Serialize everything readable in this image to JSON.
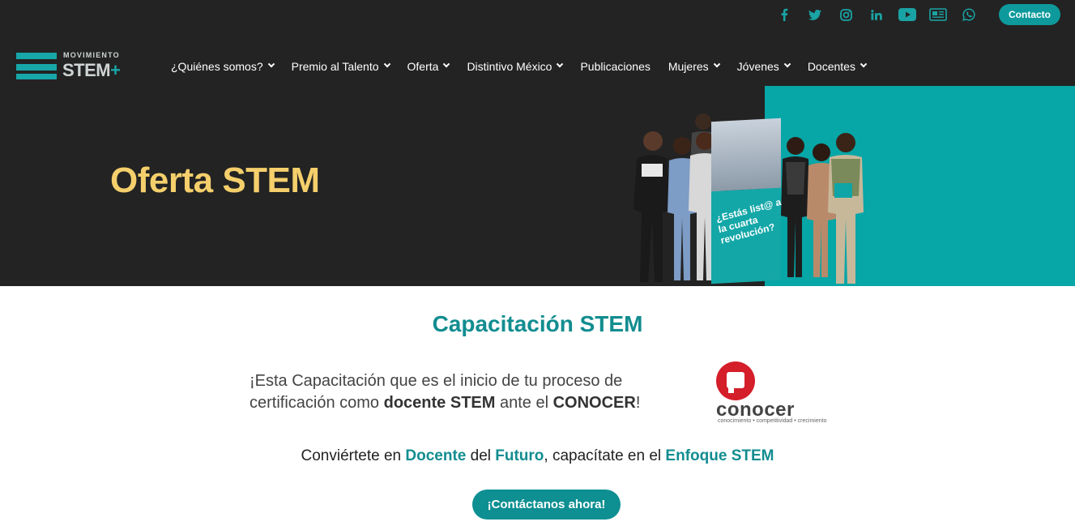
{
  "header": {
    "logo": {
      "small_text": "MOVIMIENTO",
      "big_text": "STEM",
      "plus": "+"
    },
    "social_icons": [
      "facebook-icon",
      "twitter-icon",
      "instagram-icon",
      "linkedin-icon",
      "youtube-icon",
      "newspaper-icon",
      "whatsapp-icon"
    ],
    "contact_label": "Contacto",
    "nav": [
      {
        "label": "¿Quiénes somos?",
        "dropdown": true
      },
      {
        "label": "Premio al Talento",
        "dropdown": true
      },
      {
        "label": "Oferta",
        "dropdown": true
      },
      {
        "label": "Distintivo México",
        "dropdown": true
      },
      {
        "label": "Publicaciones",
        "dropdown": false
      },
      {
        "label": "Mujeres",
        "dropdown": true
      },
      {
        "label": "Jóvenes",
        "dropdown": true
      },
      {
        "label": "Docentes",
        "dropdown": true
      }
    ]
  },
  "hero": {
    "title": "Oferta STEM",
    "banner_text": "¿Estás list@ a la cuarta revolución?"
  },
  "content": {
    "section_title": "Capacitación STEM",
    "cert_part1": "¡Esta Capacitación que es el inicio de tu proceso de certificación como ",
    "cert_bold1": "docente STEM",
    "cert_part2": " ante el ",
    "cert_bold2": "CONOCER",
    "cert_part3": "!",
    "conocer_name": "conocer",
    "conocer_tagline": "conocimiento • competitividad • crecimiento",
    "sub_1": "Conviértete en ",
    "sub_hl1": "Docente",
    "sub_2": " del ",
    "sub_hl2": "Futuro",
    "sub_3": ", capacítate en el ",
    "sub_hl3": "Enfoque STEM",
    "cta_label": "¡Contáctanos ahora!"
  },
  "colors": {
    "dark_bg": "#232323",
    "teal": "#07a6a7",
    "teal_text": "#128d90",
    "hero_title": "#f4cf6b",
    "conocer_red": "#d41e2a"
  }
}
